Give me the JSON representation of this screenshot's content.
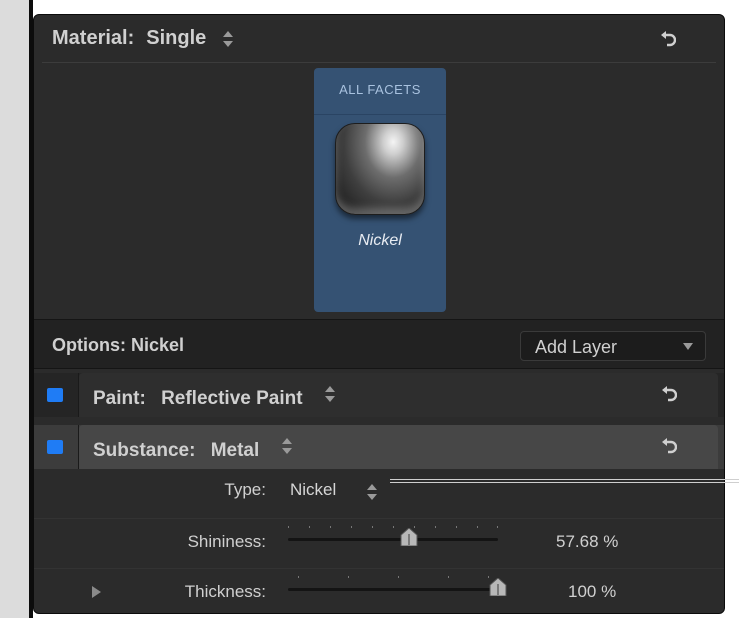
{
  "material": {
    "label": "Material:",
    "value": "Single"
  },
  "facet": {
    "title": "ALL FACETS",
    "name": "Nickel"
  },
  "options": {
    "label": "Options: Nickel",
    "add_layer_label": "Add Layer"
  },
  "layers": [
    {
      "key": "Paint:",
      "value": "Reflective Paint",
      "enabled": true
    },
    {
      "key": "Substance:",
      "value": "Metal",
      "enabled": true
    }
  ],
  "params": {
    "type": {
      "label": "Type:",
      "value": "Nickel"
    },
    "shininess": {
      "label": "Shininess:",
      "value": "57.68 %",
      "level": 0.5768
    },
    "thickness": {
      "label": "Thickness:",
      "value": "100 %",
      "level": 1.0
    }
  },
  "colors": {
    "accent": "#1f7cf5",
    "facet_bg": "#355273",
    "panel_bg": "#2b2b2b"
  }
}
